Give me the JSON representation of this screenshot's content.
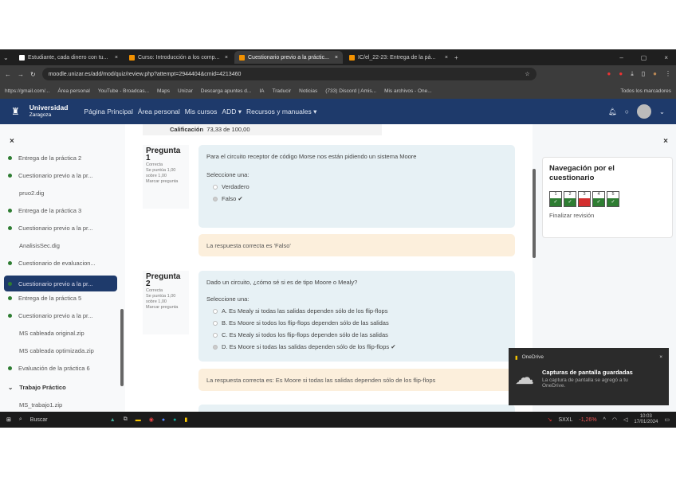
{
  "browser": {
    "tabs": [
      {
        "label": "Estudiante, cada dinero con tu..."
      },
      {
        "label": "Curso: Introducción a los comp..."
      },
      {
        "label": "Cuestionario previo a la práctic..."
      },
      {
        "label": "IC/el_22-23: Entrega de la pá..."
      }
    ],
    "url": "moodle.unizar.es/add/mod/quiz/review.php?attempt=2944404&cmid=4213460",
    "bookmarks": [
      "https://gmail.com/...",
      "Área personal",
      "YouTube - Broadcas...",
      "Maps",
      "Unizar",
      "Descarga apuntes d...",
      "IA",
      "Traducir",
      "Noticias",
      "(733) Discord | Amis...",
      "Mis archivos - One...",
      "Todos los marcadores"
    ]
  },
  "site": {
    "logo": "Universidad",
    "logo_sub": "Zaragoza",
    "nav": [
      "Página Principal",
      "Área personal",
      "Mis cursos",
      "ADD ▾",
      "Recursos y manuales ▾"
    ]
  },
  "left": {
    "close": "×",
    "items": [
      {
        "label": "Entrega de la práctica 2",
        "dot": true
      },
      {
        "label": "Cuestionario previo a la pr...",
        "dot": true
      },
      {
        "label": "pruo2.dig",
        "dot": false
      },
      {
        "label": "Entrega de la práctica 3",
        "dot": true
      },
      {
        "label": "Cuestionario previo a la pr...",
        "dot": true
      },
      {
        "label": "AnalisisSec.dig",
        "dot": false
      },
      {
        "label": "Cuestionario de evaluacion...",
        "dot": true
      },
      {
        "label": "Cuestionario previo a la pr...",
        "dot": true,
        "active": true
      },
      {
        "label": "Entrega de la práctica 5",
        "dot": true
      },
      {
        "label": "Cuestionario previo a la pr...",
        "dot": true
      },
      {
        "label": "MS cableada original.zip",
        "dot": false
      },
      {
        "label": "MS cableada optimizada.zip",
        "dot": false
      },
      {
        "label": "Evaluación de la práctica 6",
        "dot": true
      }
    ],
    "section": "Trabajo Práctico",
    "section_item": "MS_trabajo1.zip"
  },
  "main": {
    "grade_label": "Calificación",
    "grade_value": "73,33 de 100,00",
    "q1": {
      "title": "Pregunta",
      "num": "1",
      "state": "Correcta",
      "score": "Se puntúa 1,00 sobre 1,00",
      "flag": "Marcar pregunta",
      "text": "Para el circuito receptor de código Morse nos están pidiendo un sistema Moore",
      "select": "Seleccione una:",
      "options": [
        "Verdadero",
        "Falso ✔"
      ],
      "feedback": "La respuesta correcta es 'Falso'"
    },
    "q2": {
      "title": "Pregunta",
      "num": "2",
      "state": "Correcta",
      "score": "Se puntúa 1,00 sobre 1,00",
      "flag": "Marcar pregunta",
      "text": "Dado un circuito, ¿cómo sé si es de tipo Moore o Mealy?",
      "select": "Seleccione una:",
      "options": [
        "A.  Es Mealy si todas las salidas dependen sólo de los flip-flops",
        "B.  Es Moore si todos los flip-flops dependen sólo de las salidas",
        "C.  Es Mealy si todos los flip-flops dependen sólo de las salidas",
        "D.  Es Moore si todas las salidas dependen sólo de los flip-flops ✔"
      ],
      "feedback": "La respuesta correcta es: Es Moore si todas las salidas dependen sólo de los flip-flops"
    }
  },
  "quiznav": {
    "title": "Navegación por el cuestionario",
    "questions": [
      {
        "n": "1",
        "status": "correct"
      },
      {
        "n": "2",
        "status": "correct"
      },
      {
        "n": "3",
        "status": "incorrect"
      },
      {
        "n": "4",
        "status": "correct"
      },
      {
        "n": "5",
        "status": "correct"
      }
    ],
    "finish": "Finalizar revisión",
    "close": "×"
  },
  "toast": {
    "app": "OneDrive",
    "title": "Capturas de pantalla guardadas",
    "body": "La captura de pantalla se agregó a tu OneDrive.",
    "close": "×"
  },
  "taskbar": {
    "search": "Buscar",
    "stock": "SXXL",
    "change": "-1,26%",
    "time": "10:03",
    "date": "17/01/2024"
  },
  "colors": {
    "navbar": "#1e3a6b",
    "correct": "#2e7d32",
    "incorrect": "#d32f2f"
  }
}
